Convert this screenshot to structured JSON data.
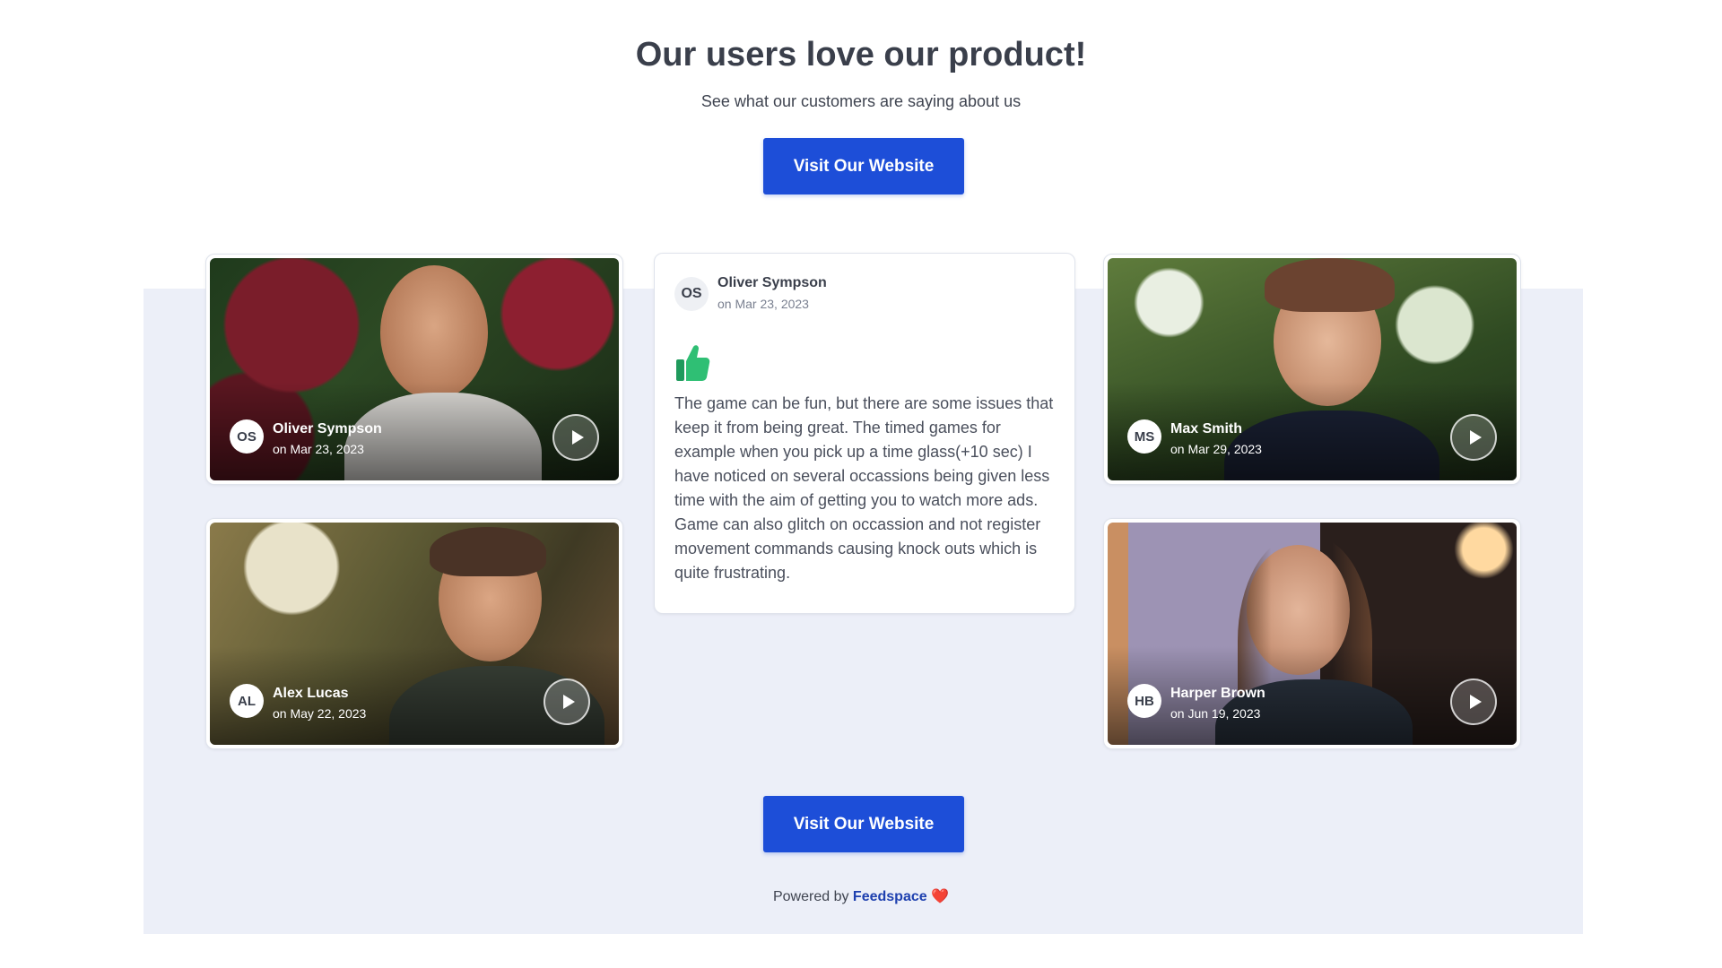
{
  "header": {
    "title": "Our users love our product!",
    "subtitle": "See what our customers are saying about us"
  },
  "cta": {
    "top_label": "Visit Our Website",
    "bottom_label": "Visit Our Website",
    "color": "#1d4ed8"
  },
  "video_cards": [
    {
      "initials": "OS",
      "name": "Oliver Sympson",
      "date": "on Mar 23, 2023"
    },
    {
      "initials": "MS",
      "name": "Max Smith",
      "date": "on Mar 29, 2023"
    },
    {
      "initials": "AL",
      "name": "Alex Lucas",
      "date": "on May 22, 2023"
    },
    {
      "initials": "HB",
      "name": "Harper Brown",
      "date": "on Jun 19, 2023"
    }
  ],
  "text_card": {
    "initials": "OS",
    "name": "Oliver Sympson",
    "date": "on Mar 23, 2023",
    "icon": "thumbs-up-icon",
    "body": "The game can be fun, but there are some issues that keep it from being great. The timed games for example when you pick up a time glass(+10 sec) I have noticed on several occassions being given less time with the aim of getting you to watch more ads. Game can also glitch on occassion and not register movement commands causing knock outs which is quite frustrating."
  },
  "footer": {
    "powered_by": "Powered by",
    "brand": "Feedspace",
    "heart": "❤️"
  },
  "colors": {
    "band_background": "#eceff8",
    "thumb_icon": "#22a565",
    "brand_link": "#1e40af"
  }
}
